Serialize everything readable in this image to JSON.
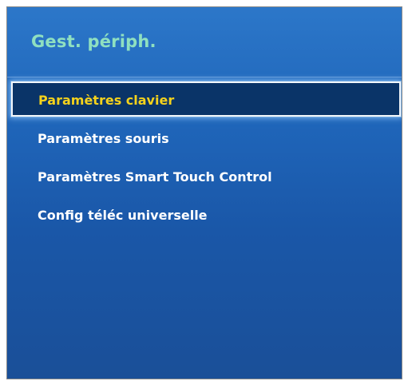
{
  "menu": {
    "title": "Gest. périph.",
    "items": [
      {
        "label": "Paramètres clavier",
        "selected": true
      },
      {
        "label": "Paramètres souris",
        "selected": false
      },
      {
        "label": "Paramètres Smart Touch Control",
        "selected": false
      },
      {
        "label": "Config téléc universelle",
        "selected": false
      }
    ]
  },
  "colors": {
    "panel_background": "#1f65b9",
    "title_text": "#8fe0c0",
    "item_text": "#ffffff",
    "selected_item_text": "#f4d21c",
    "selected_item_background": "#0a3468",
    "selected_item_border": "#f2f6fa"
  }
}
